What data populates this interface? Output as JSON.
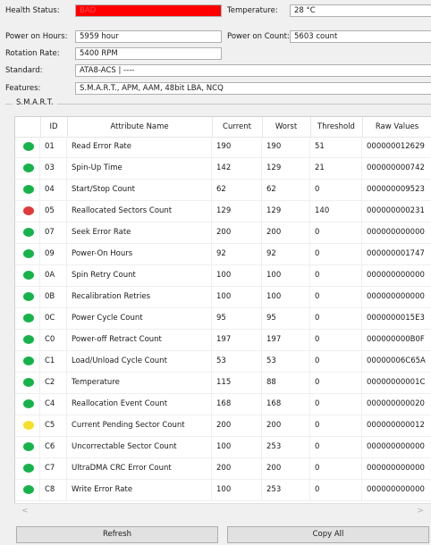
{
  "info": {
    "health_status_label": "Health Status:",
    "health_status_value": "BAD",
    "temperature_label": "Temperature:",
    "temperature_value": "28 °C",
    "power_on_hours_label": "Power on Hours:",
    "power_on_hours_value": "5959 hour",
    "power_on_count_label": "Power on Count:",
    "power_on_count_value": "5603 count",
    "rotation_rate_label": "Rotation Rate:",
    "rotation_rate_value": "5400 RPM",
    "standard_label": "Standard:",
    "standard_value": "ATA8-ACS | ----",
    "features_label": "Features:",
    "features_value": "S.M.A.R.T., APM, AAM, 48bit LBA, NCQ"
  },
  "smart": {
    "group_title": "S.M.A.R.T.",
    "columns": [
      "ID",
      "Attribute Name",
      "Current",
      "Worst",
      "Threshold",
      "Raw Values"
    ],
    "rows": [
      {
        "status": "good",
        "id": "01",
        "name": "Read Error Rate",
        "current": "190",
        "worst": "190",
        "threshold": "51",
        "raw": "000000012629"
      },
      {
        "status": "good",
        "id": "03",
        "name": "Spin-Up Time",
        "current": "142",
        "worst": "129",
        "threshold": "21",
        "raw": "000000000742"
      },
      {
        "status": "good",
        "id": "04",
        "name": "Start/Stop Count",
        "current": "62",
        "worst": "62",
        "threshold": "0",
        "raw": "000000009523"
      },
      {
        "status": "bad",
        "id": "05",
        "name": "Reallocated Sectors Count",
        "current": "129",
        "worst": "129",
        "threshold": "140",
        "raw": "000000000231"
      },
      {
        "status": "good",
        "id": "07",
        "name": "Seek Error Rate",
        "current": "200",
        "worst": "200",
        "threshold": "0",
        "raw": "000000000000"
      },
      {
        "status": "good",
        "id": "09",
        "name": "Power-On Hours",
        "current": "92",
        "worst": "92",
        "threshold": "0",
        "raw": "000000001747"
      },
      {
        "status": "good",
        "id": "0A",
        "name": "Spin Retry Count",
        "current": "100",
        "worst": "100",
        "threshold": "0",
        "raw": "000000000000"
      },
      {
        "status": "good",
        "id": "0B",
        "name": "Recalibration Retries",
        "current": "100",
        "worst": "100",
        "threshold": "0",
        "raw": "000000000000"
      },
      {
        "status": "good",
        "id": "0C",
        "name": "Power Cycle Count",
        "current": "95",
        "worst": "95",
        "threshold": "0",
        "raw": "0000000015E3"
      },
      {
        "status": "good",
        "id": "C0",
        "name": "Power-off Retract Count",
        "current": "197",
        "worst": "197",
        "threshold": "0",
        "raw": "000000000B0F"
      },
      {
        "status": "good",
        "id": "C1",
        "name": "Load/Unload Cycle Count",
        "current": "53",
        "worst": "53",
        "threshold": "0",
        "raw": "00000006C65A"
      },
      {
        "status": "good",
        "id": "C2",
        "name": "Temperature",
        "current": "115",
        "worst": "88",
        "threshold": "0",
        "raw": "00000000001C"
      },
      {
        "status": "good",
        "id": "C4",
        "name": "Reallocation Event Count",
        "current": "168",
        "worst": "168",
        "threshold": "0",
        "raw": "000000000020"
      },
      {
        "status": "caution",
        "id": "C5",
        "name": "Current Pending Sector Count",
        "current": "200",
        "worst": "200",
        "threshold": "0",
        "raw": "000000000012"
      },
      {
        "status": "good",
        "id": "C6",
        "name": "Uncorrectable Sector Count",
        "current": "100",
        "worst": "253",
        "threshold": "0",
        "raw": "000000000000"
      },
      {
        "status": "good",
        "id": "C7",
        "name": "UltraDMA CRC Error Count",
        "current": "200",
        "worst": "200",
        "threshold": "0",
        "raw": "000000000000"
      },
      {
        "status": "good",
        "id": "C8",
        "name": "Write Error Rate",
        "current": "100",
        "worst": "253",
        "threshold": "0",
        "raw": "000000000000"
      }
    ]
  },
  "status_colors": {
    "good": "#16b34a",
    "bad": "#e03a3a",
    "caution": "#f5e028"
  },
  "scrollbar": {
    "left_arrow": "<",
    "right_arrow": ">"
  },
  "buttons": {
    "refresh": "Refresh",
    "copy_all": "Copy All"
  }
}
